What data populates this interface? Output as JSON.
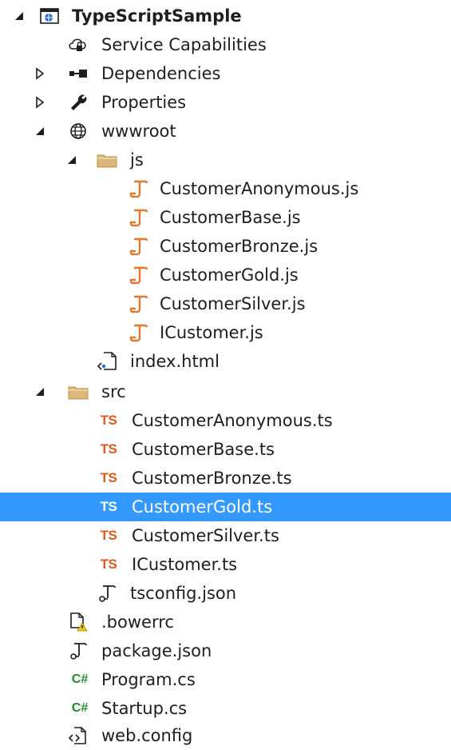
{
  "project": {
    "name": "TypeScriptSample"
  },
  "items": [
    {
      "label": "Service Capabilities",
      "icon": "cloud-lock-icon"
    },
    {
      "label": "Dependencies",
      "icon": "dependencies-icon"
    },
    {
      "label": "Properties",
      "icon": "wrench-icon"
    },
    {
      "label": "wwwroot",
      "icon": "globe-icon"
    },
    {
      "label": "js",
      "icon": "folder-icon"
    },
    {
      "label": "CustomerAnonymous.js",
      "icon": "js-file-icon"
    },
    {
      "label": "CustomerBase.js",
      "icon": "js-file-icon"
    },
    {
      "label": "CustomerBronze.js",
      "icon": "js-file-icon"
    },
    {
      "label": "CustomerGold.js",
      "icon": "js-file-icon"
    },
    {
      "label": "CustomerSilver.js",
      "icon": "js-file-icon"
    },
    {
      "label": "ICustomer.js",
      "icon": "js-file-icon"
    },
    {
      "label": "index.html",
      "icon": "html-file-icon"
    },
    {
      "label": "src",
      "icon": "folder-icon"
    },
    {
      "label": "CustomerAnonymous.ts",
      "icon": "ts-file-icon"
    },
    {
      "label": "CustomerBase.ts",
      "icon": "ts-file-icon"
    },
    {
      "label": "CustomerBronze.ts",
      "icon": "ts-file-icon"
    },
    {
      "label": "CustomerGold.ts",
      "icon": "ts-file-icon",
      "selected": true
    },
    {
      "label": "CustomerSilver.ts",
      "icon": "ts-file-icon"
    },
    {
      "label": "ICustomer.ts",
      "icon": "ts-file-icon"
    },
    {
      "label": "tsconfig.json",
      "icon": "json-file-icon"
    },
    {
      "label": ".bowerrc",
      "icon": "file-warning-icon"
    },
    {
      "label": "package.json",
      "icon": "json-file-icon"
    },
    {
      "label": "Program.cs",
      "icon": "csharp-file-icon"
    },
    {
      "label": "Startup.cs",
      "icon": "csharp-file-icon"
    },
    {
      "label": "web.config",
      "icon": "config-file-icon"
    }
  ],
  "badges": {
    "ts": "TS",
    "cs": "C#"
  },
  "colors": {
    "selection": "#3399ff",
    "ts_orange": "#e0591b",
    "js_orange": "#e8772e",
    "csharp_green": "#1e8a2e",
    "folder": "#dcb67a"
  }
}
